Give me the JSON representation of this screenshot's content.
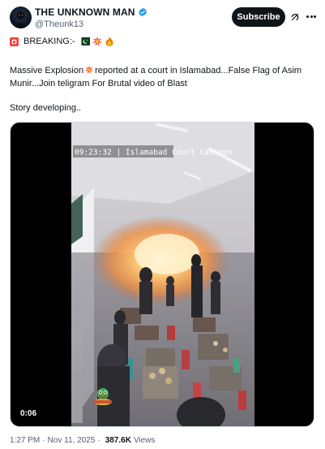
{
  "header": {
    "display_name": "THE UNKNOWN MAN",
    "handle": "@Theunk13",
    "subscribe_label": "Subscribe"
  },
  "tweet": {
    "breaking_label": "BREAKING:-",
    "text_part1": "Massive Explosion",
    "text_part2": "reported at a court in Islamabad...False Flag of Asim Munir...Join teligram For Brutal video of Blast",
    "story": "Story developing.."
  },
  "media": {
    "overlay_timestamp": "09:23:32 | Islamabad Court Canteen",
    "duration": "0:06"
  },
  "footer": {
    "time": "1:27 PM",
    "date": "Nov 11, 2025",
    "views_count": "387.6K",
    "views_label": "Views"
  },
  "icons": {
    "verified": "verified-badge-icon",
    "grok": "grok-icon",
    "more": "more-icon",
    "siren": "siren-emoji-icon",
    "flag": "pakistan-flag-emoji-icon",
    "collision": "collision-emoji-icon",
    "fire": "fire-emoji-icon"
  },
  "colors": {
    "verified_blue": "#1d9bf0",
    "text_primary": "#0f1419",
    "text_secondary": "#536471"
  }
}
